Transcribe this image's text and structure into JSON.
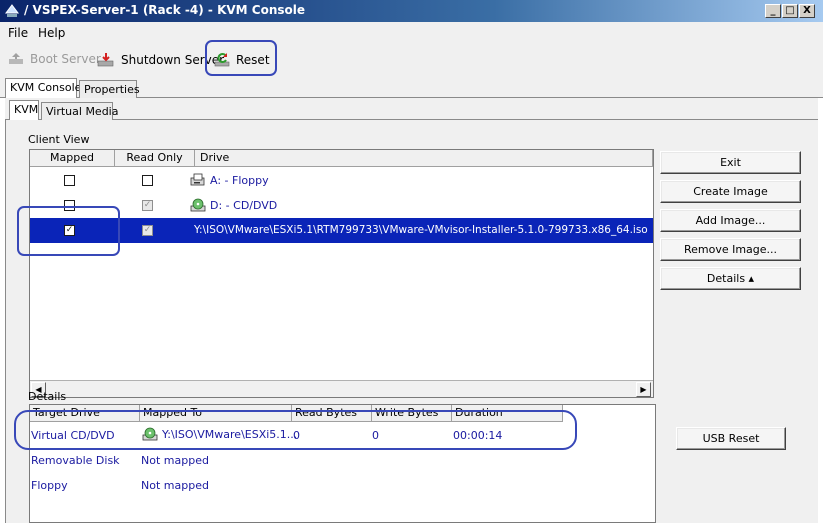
{
  "window": {
    "title": "/ VSPEX-Server-1 (Rack -4) - KVM Console",
    "controls": [
      "_",
      "□",
      "X"
    ]
  },
  "menu": [
    "File",
    "Help"
  ],
  "toolbar": {
    "boot_label": "Boot Server",
    "shutdown_label": "Shutdown Server",
    "reset_label": "Reset"
  },
  "tabs_top": [
    "KVM Console",
    "Properties"
  ],
  "tabs_sub": [
    "KVM",
    "Virtual Media"
  ],
  "client_view": {
    "label": "Client View",
    "columns": [
      "Mapped",
      "Read Only",
      "Drive"
    ],
    "rows": [
      {
        "mapped": false,
        "read_only": false,
        "drive": "A: - Floppy",
        "icon": "floppy-drive-icon"
      },
      {
        "mapped": false,
        "read_only": true,
        "drive": "D: - CD/DVD",
        "icon": "cd-drive-icon"
      },
      {
        "mapped": true,
        "read_only": true,
        "drive": "Y:\\ISO\\VMware\\ESXi5.1\\RTM799733\\VMware-VMvisor-Installer-5.1.0-799733.x86_64.iso -...",
        "icon": "cd-drive-icon",
        "selected": true
      }
    ]
  },
  "side_buttons": {
    "exit": "Exit",
    "create_image": "Create Image",
    "add_image": "Add Image...",
    "remove_image": "Remove Image...",
    "details": "Details ▴",
    "usb_reset": "USB Reset"
  },
  "details": {
    "label": "Details",
    "columns": [
      "Target Drive",
      "Mapped To",
      "Read Bytes",
      "Write Bytes",
      "Duration"
    ],
    "rows": [
      {
        "target": "Virtual CD/DVD",
        "mapped_to": "Y:\\ISO\\VMware\\ESXi5.1...",
        "read_bytes": "0",
        "write_bytes": "0",
        "duration": "00:00:14"
      },
      {
        "target": "Removable Disk",
        "mapped_to": "Not mapped"
      },
      {
        "target": "Floppy",
        "mapped_to": "Not mapped"
      }
    ]
  },
  "colors": {
    "annotation": "#3848b8",
    "selection": "#0a24b8",
    "link_text": "#1a1aa0"
  }
}
